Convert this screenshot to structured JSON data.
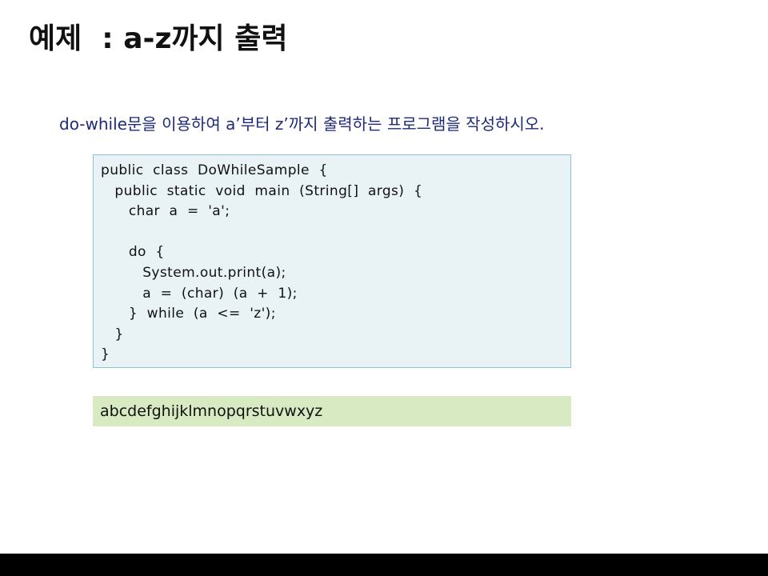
{
  "slide": {
    "title": "예제  : a-z까지 출력",
    "instruction": "do-while문을 이용하여 a’부터 z’까지 출력하는 프로그램을 작성하시오."
  },
  "code": {
    "lines": [
      "public  class  DoWhileSample  {",
      "   public  static  void  main  (String[]  args)  {",
      "      char  a  =  'a';",
      "",
      "      do  {",
      "         System.out.print(a);",
      "         a  =  (char)  (a  +  1);",
      "      }  while  (a  <=  'z');",
      "   }",
      "}"
    ]
  },
  "output": {
    "text": "abcdefghijklmnopqrstuvwxyz"
  }
}
